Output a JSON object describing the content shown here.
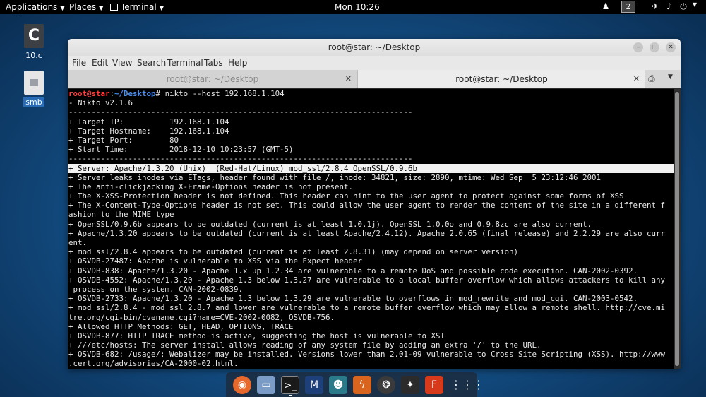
{
  "topbar": {
    "applications": "Applications",
    "places": "Places",
    "app_name": "Terminal",
    "clock": "Mon 10:26",
    "workspace": "2"
  },
  "desktop": {
    "icons": [
      {
        "label": "10.c",
        "glyph": "C"
      },
      {
        "label": "smb"
      }
    ]
  },
  "window": {
    "title": "root@star: ~/Desktop",
    "menu": [
      "File",
      "Edit",
      "View",
      "Search",
      "Terminal",
      "Tabs",
      "Help"
    ],
    "tabs": [
      {
        "label": "root@star: ~/Desktop",
        "active": false
      },
      {
        "label": "root@star: ~/Desktop",
        "active": true
      }
    ]
  },
  "terminal": {
    "prompt_user": "root@star",
    "prompt_sep": ":",
    "prompt_dir": "~/Desktop",
    "prompt_end": "#",
    "command": " nikto --host 192.168.1.104",
    "lines": [
      "- Nikto v2.1.6",
      "---------------------------------------------------------------------------",
      "+ Target IP:          192.168.1.104",
      "+ Target Hostname:    192.168.1.104",
      "+ Target Port:        80",
      "+ Start Time:         2018-12-10 10:23:57 (GMT-5)",
      "---------------------------------------------------------------------------",
      "+ Server: Apache/1.3.20 (Unix)  (Red-Hat/Linux) mod_ssl/2.8.4 OpenSSL/0.9.6b",
      "+ Server leaks inodes via ETags, header found with file /, inode: 34821, size: 2890, mtime: Wed Sep  5 23:12:46 2001",
      "+ The anti-clickjacking X-Frame-Options header is not present.",
      "+ The X-XSS-Protection header is not defined. This header can hint to the user agent to protect against some forms of XSS",
      "+ The X-Content-Type-Options header is not set. This could allow the user agent to render the content of the site in a different f",
      "ashion to the MIME type",
      "+ OpenSSL/0.9.6b appears to be outdated (current is at least 1.0.1j). OpenSSL 1.0.0o and 0.9.8zc are also current.",
      "+ Apache/1.3.20 appears to be outdated (current is at least Apache/2.4.12). Apache 2.0.65 (final release) and 2.2.29 are also curr",
      "ent.",
      "+ mod_ssl/2.8.4 appears to be outdated (current is at least 2.8.31) (may depend on server version)",
      "+ OSVDB-27487: Apache is vulnerable to XSS via the Expect header",
      "+ OSVDB-838: Apache/1.3.20 - Apache 1.x up 1.2.34 are vulnerable to a remote DoS and possible code execution. CAN-2002-0392.",
      "+ OSVDB-4552: Apache/1.3.20 - Apache 1.3 below 1.3.27 are vulnerable to a local buffer overflow which allows attackers to kill any",
      " process on the system. CAN-2002-0839.",
      "+ OSVDB-2733: Apache/1.3.20 - Apache 1.3 below 1.3.29 are vulnerable to overflows in mod_rewrite and mod_cgi. CAN-2003-0542.",
      "+ mod_ssl/2.8.4 - mod_ssl 2.8.7 and lower are vulnerable to a remote buffer overflow which may allow a remote shell. http://cve.mi",
      "tre.org/cgi-bin/cvename.cgi?name=CVE-2002-0082, OSVDB-756.",
      "+ Allowed HTTP Methods: GET, HEAD, OPTIONS, TRACE",
      "+ OSVDB-877: HTTP TRACE method is active, suggesting the host is vulnerable to XST",
      "+ ///etc/hosts: The server install allows reading of any system file by adding an extra '/' to the URL.",
      "+ OSVDB-682: /usage/: Webalizer may be installed. Versions lower than 2.01-09 vulnerable to Cross Site Scripting (XSS). http://www",
      ".cert.org/advisories/CA-2000-02.html."
    ],
    "highlighted_line": 7
  },
  "dock": {
    "items": [
      "firefox-icon",
      "files-icon",
      "terminal-icon",
      "metasploit-icon",
      "armitage-icon",
      "burpsuite-icon",
      "maltego-icon",
      "beef-icon",
      "faraday-icon",
      "show-apps-icon"
    ]
  }
}
